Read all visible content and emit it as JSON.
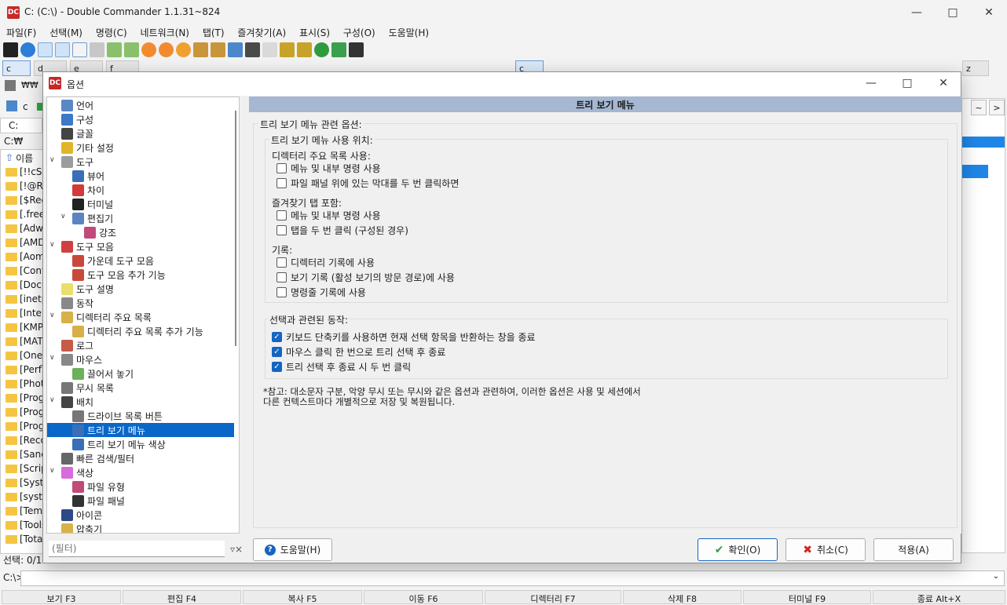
{
  "window": {
    "title": "C: (C:\\) - Double Commander 1.1.31~824",
    "logo": "DC"
  },
  "menubar": [
    "파일(F)",
    "선택(M)",
    "명령(C)",
    "네트워크(N)",
    "탭(T)",
    "즐겨찾기(A)",
    "표시(S)",
    "구성(O)",
    "도움말(H)"
  ],
  "left_panel": {
    "drive": "c",
    "path_prefix": "C:",
    "current": "C:₩",
    "col_name": "이름",
    "files": [
      "[!!cSk",
      "[!@RI",
      "[$Rec",
      "[.free",
      "[Adw",
      "[AMD",
      "[Aom",
      "[Conf",
      "[Docu",
      "[inetp",
      "[Intel",
      "[KMP",
      "[MAT",
      "[OneL",
      "[Perfl",
      "[Phot",
      "[Prog",
      "[Prog",
      "[Prog",
      "[Reco",
      "[Sanc",
      "[Scrip",
      "[Syste",
      "[syste",
      "[Tem",
      "[Tools",
      "[Tota"
    ],
    "status": "선택: 0/1"
  },
  "cmdline_prompt": "C:\\>",
  "function_keys": [
    "보기 F3",
    "편집 F4",
    "복사 F5",
    "이동 F6",
    "디렉터리 F7",
    "삭제 F8",
    "터미널 F9",
    "종료 Alt+X"
  ],
  "dialog": {
    "title": "옵션",
    "tree": [
      {
        "label": "언어",
        "level": 0
      },
      {
        "label": "구성",
        "level": 0
      },
      {
        "label": "글꼴",
        "level": 0
      },
      {
        "label": "기타 설정",
        "level": 0
      },
      {
        "label": "도구",
        "level": 0,
        "expanded": true
      },
      {
        "label": "뷰어",
        "level": 1
      },
      {
        "label": "차이",
        "level": 1
      },
      {
        "label": "터미널",
        "level": 1
      },
      {
        "label": "편집기",
        "level": 1,
        "expanded": true
      },
      {
        "label": "강조",
        "level": 2
      },
      {
        "label": "도구 모음",
        "level": 0,
        "expanded": true
      },
      {
        "label": "가운데 도구 모음",
        "level": 1
      },
      {
        "label": "도구 모음 추가 기능",
        "level": 1
      },
      {
        "label": "도구 설명",
        "level": 0
      },
      {
        "label": "동작",
        "level": 0
      },
      {
        "label": "디렉터리 주요 목록",
        "level": 0,
        "expanded": true
      },
      {
        "label": "디렉터리 주요 목록 추가 기능",
        "level": 1
      },
      {
        "label": "로그",
        "level": 0
      },
      {
        "label": "마우스",
        "level": 0,
        "expanded": true
      },
      {
        "label": "끌어서 놓기",
        "level": 1
      },
      {
        "label": "무시 목록",
        "level": 0
      },
      {
        "label": "배치",
        "level": 0,
        "expanded": true
      },
      {
        "label": "드라이브 목록 버튼",
        "level": 1
      },
      {
        "label": "트리 보기 메뉴",
        "level": 1,
        "selected": true
      },
      {
        "label": "트리 보기 메뉴 색상",
        "level": 1
      },
      {
        "label": "빠른 검색/필터",
        "level": 0
      },
      {
        "label": "색상",
        "level": 0,
        "expanded": true
      },
      {
        "label": "파일 유형",
        "level": 1
      },
      {
        "label": "파일 패널",
        "level": 1
      },
      {
        "label": "아이콘",
        "level": 0
      },
      {
        "label": "압축기",
        "level": 0
      }
    ],
    "header": "트리 보기 메뉴",
    "group_main": "트리 보기 메뉴 관련 옵션:",
    "group_use": "트리 보기 메뉴 사용 위치:",
    "sec_dir": "디렉터리 주요 목록 사용:",
    "cb_dir_1": "메뉴 및 내부 명령 사용",
    "cb_dir_2": "파일 패널 위에 있는 막대를 두 번 클릭하면",
    "sec_fav": "즐겨찾기 탭 포함:",
    "cb_fav_1": "메뉴 및 내부 명령 사용",
    "cb_fav_2": "탭을 두 번 클릭 (구성된 경우)",
    "sec_hist": "기록:",
    "cb_hist_1": "디렉터리 기록에 사용",
    "cb_hist_2": "보기 기록 (활성 보기의 방문 경로)에 사용",
    "cb_hist_3": "명령줄 기록에 사용",
    "group_sel": "선택과 관련된 동작:",
    "cb_sel_1": "키보드 단축키를 사용하면 현재 선택 항목을 반환하는 창을 종료",
    "cb_sel_2": "마우스 클릭 한 번으로 트리 선택 후 종료",
    "cb_sel_3": "트리 선택 후 종료 시 두 번 클릭",
    "note_1": "*참고: 대소문자 구분, 악양 무시 또는 무시와 같은 옵션과 관련하여, 이러한 옵션은 사용 및 세션에서",
    "note_2": "다른 컨텍스트마다 개별적으로 저장 및 복원됩니다.",
    "filter_placeholder": "(필터)",
    "help_btn": "도움말(H)",
    "ok_btn": "확인(O)",
    "cancel_btn": "취소(C)",
    "apply_btn": "적용(A)"
  },
  "checks": {
    "dir_1": false,
    "dir_2": false,
    "fav_1": false,
    "fav_2": false,
    "hist_1": false,
    "hist_2": false,
    "hist_3": false,
    "sel_1": true,
    "sel_2": true,
    "sel_3": true
  },
  "colors": {
    "accent": "#1665c1",
    "header": "#a5b7d1",
    "selection": "#0a67c8"
  }
}
